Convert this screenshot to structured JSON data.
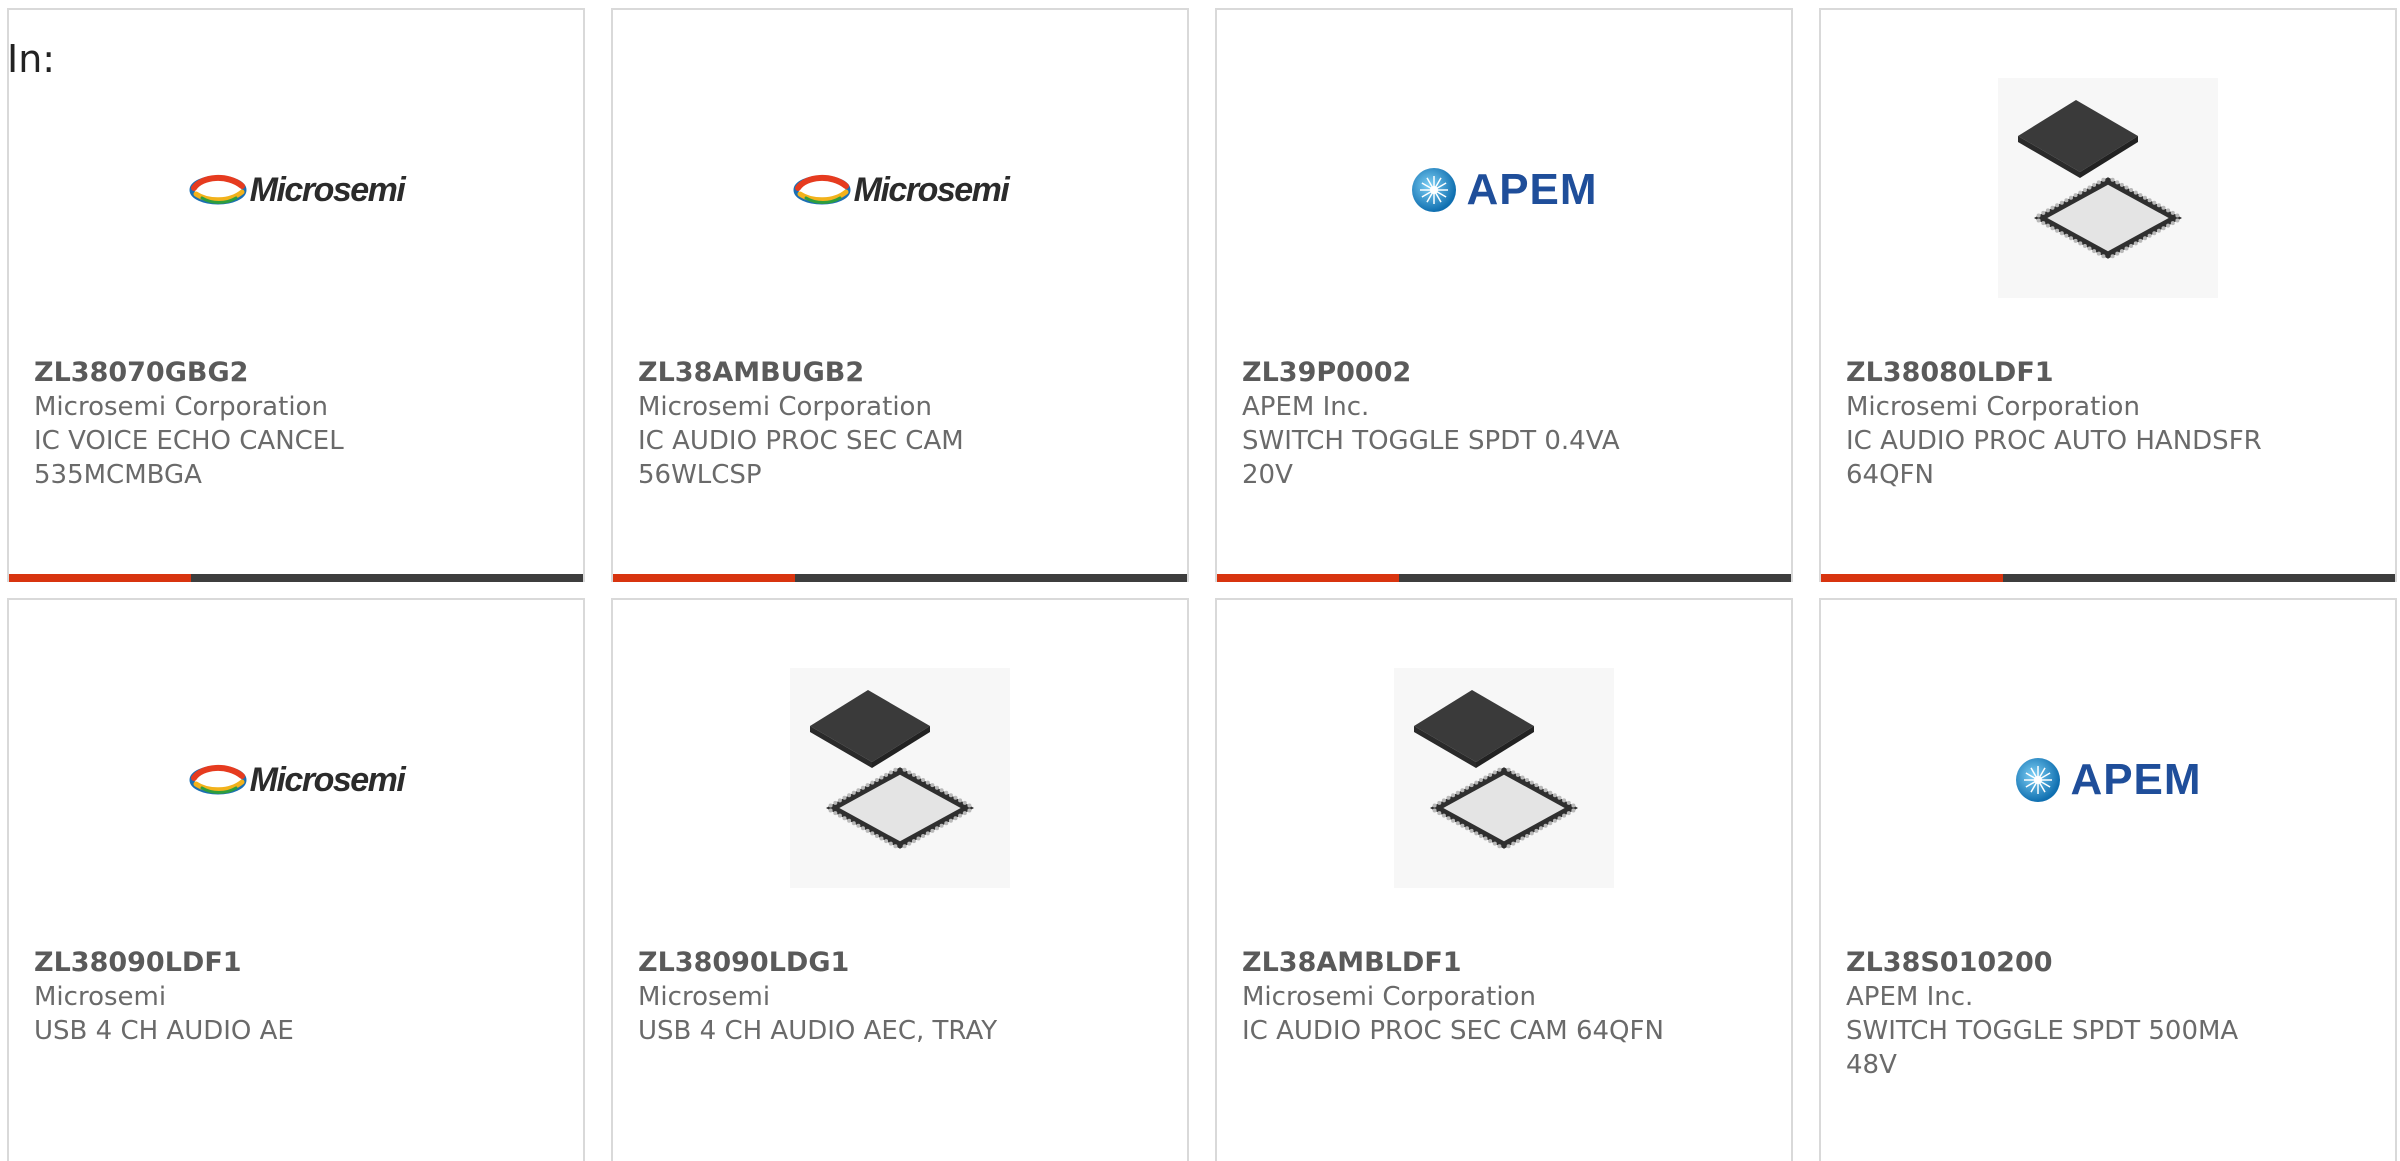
{
  "filter_label": "In:",
  "colors": {
    "accent": "#d8340f",
    "bar": "#3d3d3d",
    "microsemi_blue": "#1b6fb3",
    "apem_blue": "#1f4e9a"
  },
  "cards": [
    {
      "part_number": "ZL38070GBG2",
      "manufacturer": "Microsemi Corporation",
      "description_line1": "IC VOICE ECHO CANCEL",
      "description_line2": "535MCMBGA",
      "image": "microsemi-logo",
      "logo_text": "Microsemi"
    },
    {
      "part_number": "ZL38AMBUGB2",
      "manufacturer": "Microsemi Corporation",
      "description_line1": "IC AUDIO PROC SEC CAM",
      "description_line2": "56WLCSP",
      "image": "microsemi-logo",
      "logo_text": "Microsemi"
    },
    {
      "part_number": "ZL39P0002",
      "manufacturer": "APEM Inc.",
      "description_line1": "SWITCH TOGGLE SPDT 0.4VA",
      "description_line2": "20V",
      "image": "apem-logo",
      "logo_text": "APEM"
    },
    {
      "part_number": "ZL38080LDF1",
      "manufacturer": "Microsemi Corporation",
      "description_line1": "IC AUDIO PROC AUTO HANDSFR",
      "description_line2": "64QFN",
      "image": "qfn-chip-photo",
      "logo_text": ""
    },
    {
      "part_number": "ZL38090LDF1",
      "manufacturer": "Microsemi",
      "description_line1": "USB 4 CH AUDIO AE",
      "description_line2": "",
      "image": "microsemi-logo",
      "logo_text": "Microsemi"
    },
    {
      "part_number": "ZL38090LDG1",
      "manufacturer": "Microsemi",
      "description_line1": "USB 4 CH AUDIO AEC, TRAY",
      "description_line2": "",
      "image": "qfn-chip-photo",
      "logo_text": ""
    },
    {
      "part_number": "ZL38AMBLDF1",
      "manufacturer": "Microsemi Corporation",
      "description_line1": "IC AUDIO PROC SEC CAM 64QFN",
      "description_line2": "",
      "image": "qfn-chip-photo",
      "logo_text": ""
    },
    {
      "part_number": "ZL38S010200",
      "manufacturer": "APEM Inc.",
      "description_line1": "SWITCH TOGGLE SPDT 500MA",
      "description_line2": "48V",
      "image": "apem-logo",
      "logo_text": "APEM"
    }
  ]
}
